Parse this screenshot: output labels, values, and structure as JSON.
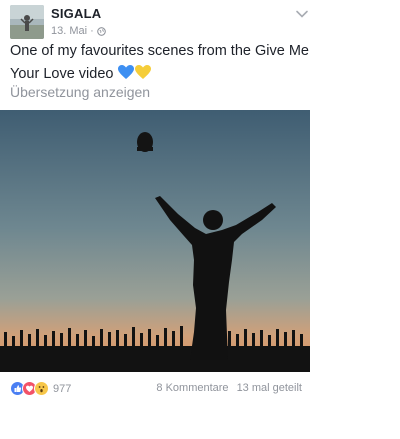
{
  "post": {
    "page_name": "SIGALA",
    "date": "13. Mai",
    "separator": "·",
    "audience_icon": "globe-icon",
    "menu_icon": "chevron-down-icon",
    "text": "One of my favourites scenes from the Give Me Your Love video",
    "emoji": "blue-heart yellow-heart",
    "translate_label": "Übersetzung anzeigen",
    "photo_alt": "Silhouette of a man with raised arms throwing a hat at sunset",
    "reactions": {
      "icons": [
        "like-icon",
        "love-icon",
        "wow-icon"
      ],
      "count": "977"
    },
    "comments": "8 Kommentare",
    "shares": "13 mal geteilt"
  },
  "colors": {
    "text": "#1d2129",
    "secondary": "#90949c",
    "like": "#4a7ff3",
    "love": "#f25268",
    "wow": "#f7c74a"
  }
}
